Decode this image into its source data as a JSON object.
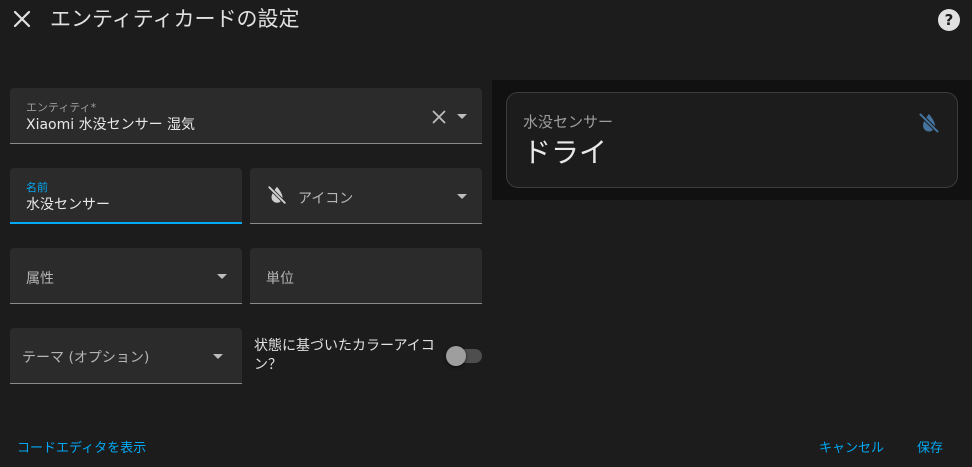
{
  "dialog": {
    "title": "エンティティカードの設定",
    "close_icon": "close-icon",
    "help_icon": "help-circle-icon",
    "help_glyph": "?"
  },
  "form": {
    "entity": {
      "label": "エンティティ*",
      "value": "Xiaomi 水没センサー 湿気"
    },
    "name": {
      "label": "名前",
      "value": "水没センサー"
    },
    "icon": {
      "placeholder": "アイコン",
      "icon": "water-off-icon"
    },
    "attribute": {
      "placeholder": "属性"
    },
    "unit": {
      "placeholder": "単位"
    },
    "theme": {
      "placeholder": "テーマ (オプション)"
    },
    "state_color": {
      "label": "状態に基づいたカラーアイコン？",
      "checked": false
    }
  },
  "preview": {
    "card_name": "水没センサー",
    "card_state": "ドライ",
    "card_icon": "water-off-icon",
    "icon_color": "#44739e"
  },
  "footer": {
    "code_editor": "コードエディタを表示",
    "cancel": "キャンセル",
    "save": "保存"
  },
  "colors": {
    "accent": "#03a9f4",
    "background": "#1c1c1c",
    "field_bg": "#2b2b2b"
  }
}
